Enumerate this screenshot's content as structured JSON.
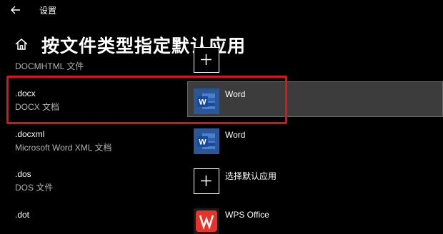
{
  "window": {
    "title": "设置"
  },
  "header": {
    "title": "按文件类型指定默认应用"
  },
  "rows": [
    {
      "ext": "",
      "desc": "DOCMHTML 文件",
      "app": ""
    },
    {
      "ext": ".docx",
      "desc": "DOCX 文档",
      "app": "Word"
    },
    {
      "ext": ".docxml",
      "desc": "Microsoft Word XML 文档",
      "app": "Word"
    },
    {
      "ext": ".dos",
      "desc": "DOS 文件",
      "app": "选择默认应用"
    },
    {
      "ext": ".dot",
      "desc": "",
      "app": "WPS Office"
    }
  ],
  "icons": {
    "back": "arrow-left-icon",
    "home": "home-icon",
    "plus": "plus-icon",
    "word": "word-icon",
    "wps": "wps-icon"
  },
  "colors": {
    "background": "#000000",
    "highlight": "#d8141d",
    "selected": "#3c3c3c",
    "word_blue": "#2b5797",
    "wps_red": "#e8332b"
  }
}
